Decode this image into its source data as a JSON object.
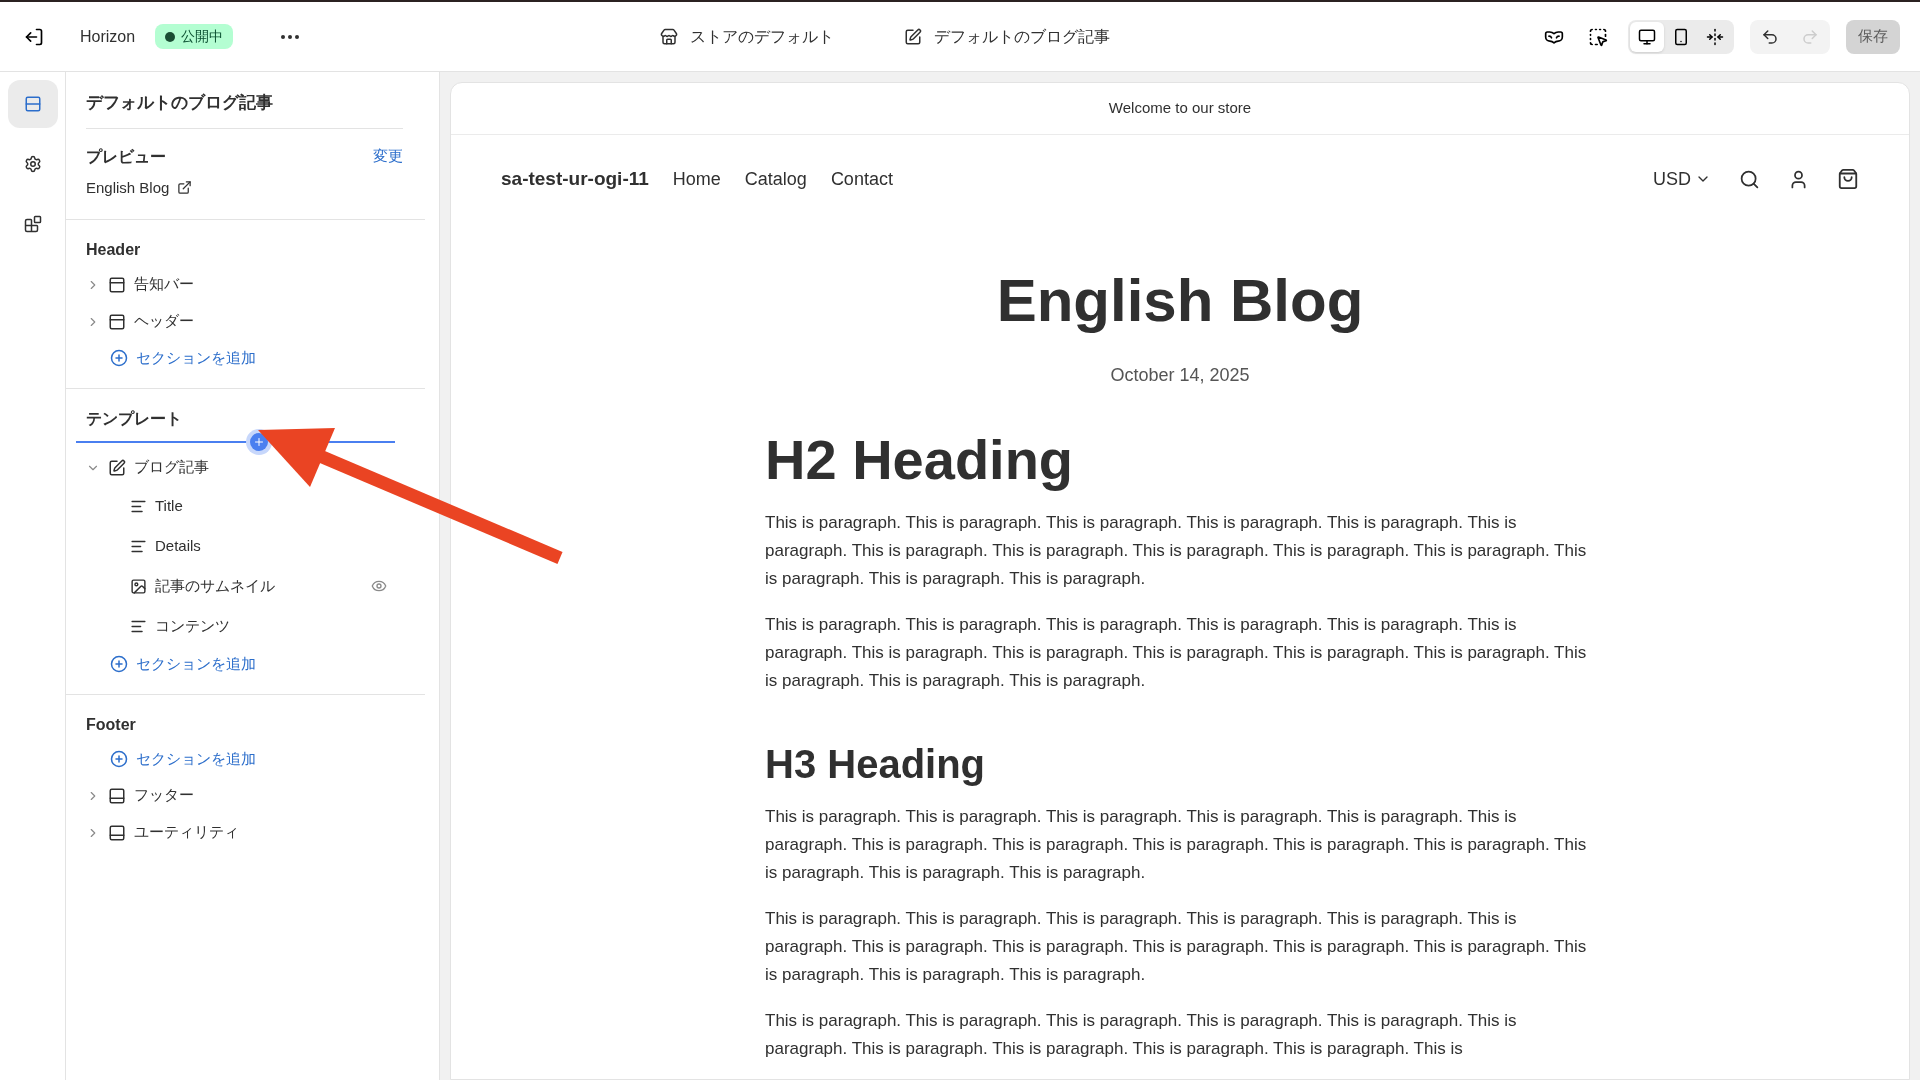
{
  "topbar": {
    "app_name": "Horizon",
    "status": {
      "label": "公開中",
      "color": "#1a4d33"
    },
    "center_tabs": [
      {
        "kind": "store",
        "label": "ストアのデフォルト"
      },
      {
        "kind": "post",
        "label": "デフォルトのブログ記事"
      }
    ],
    "view_modes": [
      {
        "kind": "desktop",
        "selected": true
      },
      {
        "kind": "mobile",
        "selected": false
      },
      {
        "kind": "fullwidth",
        "selected": false
      }
    ],
    "undo": {
      "disabled": false
    },
    "redo": {
      "disabled": true
    },
    "save": {
      "label": "保存",
      "disabled": true
    }
  },
  "rail": [
    {
      "kind": "sections",
      "selected": true
    },
    {
      "kind": "settings",
      "selected": false
    },
    {
      "kind": "apps",
      "selected": false
    }
  ],
  "sidebar": {
    "title": "デフォルトのブログ記事",
    "preview": {
      "label": "プレビュー",
      "change": "変更",
      "value": "English Blog"
    },
    "groups": [
      {
        "title": "Header",
        "items": [
          {
            "kind": "top",
            "label": "告知バー",
            "expanded": false
          },
          {
            "kind": "top",
            "label": "ヘッダー",
            "expanded": false
          },
          {
            "kind": "add",
            "label": "セクションを追加"
          }
        ]
      },
      {
        "title": "テンプレート",
        "drop_indicator": true,
        "items": [
          {
            "kind": "post",
            "label": "ブログ記事",
            "expanded": true,
            "children": [
              {
                "kind": "text",
                "label": "Title",
                "eye": false
              },
              {
                "kind": "text",
                "label": "Details",
                "eye": false
              },
              {
                "kind": "image",
                "label": "記事のサムネイル",
                "eye": true
              },
              {
                "kind": "text",
                "label": "コンテンツ",
                "eye": false
              }
            ]
          },
          {
            "kind": "add",
            "label": "セクションを追加"
          }
        ]
      },
      {
        "title": "Footer",
        "items": [
          {
            "kind": "add",
            "label": "セクションを追加"
          },
          {
            "kind": "bottom",
            "label": "フッター",
            "expanded": false
          },
          {
            "kind": "bottom",
            "label": "ユーティリティ",
            "expanded": false
          }
        ]
      }
    ]
  },
  "annotation_arrow": true,
  "preview": {
    "announcement": "Welcome to our store",
    "store_name": "sa-test-ur-ogi-11",
    "nav": [
      "Home",
      "Catalog",
      "Contact"
    ],
    "currency": "USD",
    "title": "English Blog",
    "date": "October 14, 2025",
    "blocks": [
      {
        "kind": "h2",
        "text": "H2 Heading"
      },
      {
        "kind": "p",
        "text": "This is paragraph. This is paragraph. This is paragraph. This is paragraph. This is paragraph. This is paragraph. This is paragraph. This is paragraph. This is paragraph. This is paragraph. This is paragraph. This is paragraph. This is paragraph. This is paragraph."
      },
      {
        "kind": "p",
        "text": "This is paragraph. This is paragraph. This is paragraph. This is paragraph. This is paragraph. This is paragraph. This is paragraph. This is paragraph. This is paragraph. This is paragraph. This is paragraph. This is paragraph. This is paragraph. This is paragraph."
      },
      {
        "kind": "h3",
        "text": "H3 Heading"
      },
      {
        "kind": "p",
        "text": "This is paragraph. This is paragraph. This is paragraph. This is paragraph. This is paragraph. This is paragraph. This is paragraph. This is paragraph. This is paragraph. This is paragraph. This is paragraph. This is paragraph. This is paragraph. This is paragraph."
      },
      {
        "kind": "p",
        "text": "This is paragraph. This is paragraph. This is paragraph. This is paragraph. This is paragraph. This is paragraph. This is paragraph. This is paragraph. This is paragraph. This is paragraph. This is paragraph. This is paragraph. This is paragraph. This is paragraph."
      },
      {
        "kind": "p",
        "text": "This is paragraph. This is paragraph. This is paragraph. This is paragraph. This is paragraph. This is paragraph. This is paragraph. This is paragraph. This is paragraph. This is paragraph. This is"
      }
    ]
  }
}
